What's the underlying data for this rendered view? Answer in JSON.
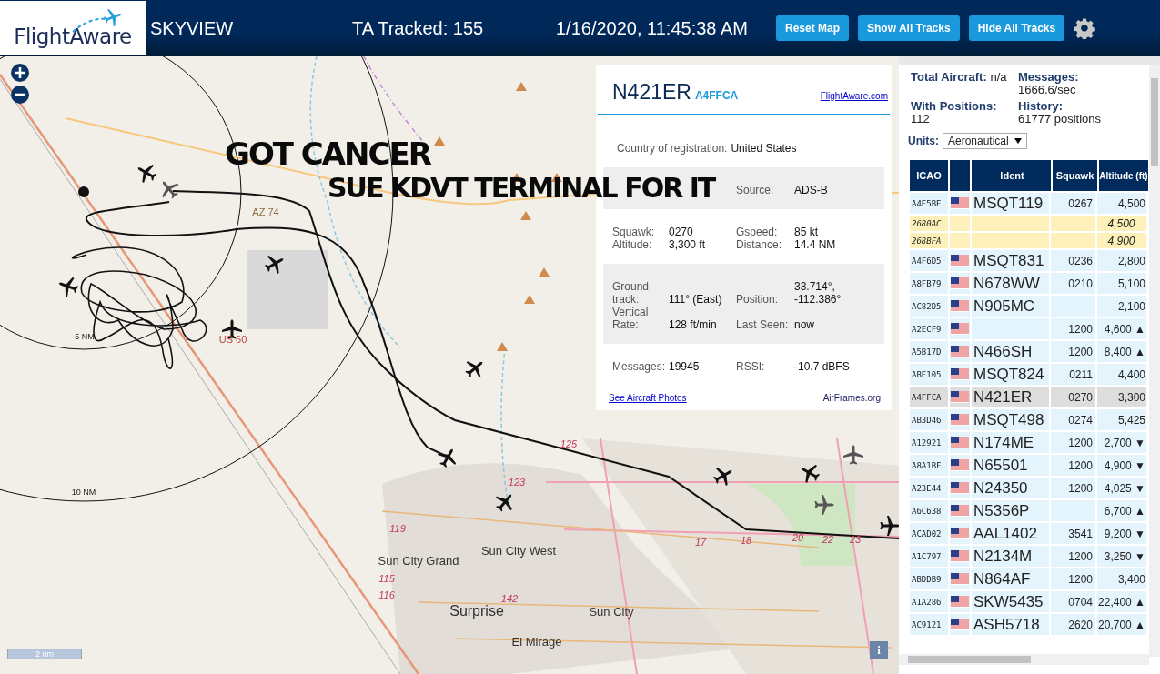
{
  "header": {
    "logo": "FlightAware",
    "title": "SKYVIEW",
    "tracked": "TA Tracked: 155",
    "datetime": "1/16/2020, 11:45:38 AM",
    "buttons": [
      "Reset Map",
      "Show All Tracks",
      "Hide All Tracks"
    ]
  },
  "map": {
    "scale": "2 nm",
    "info": "i",
    "labels": [
      {
        "text": "5 NM",
        "kind": "ring"
      },
      {
        "text": "10 NM",
        "kind": "ring"
      },
      {
        "text": "AZ 74",
        "kind": "state-shield"
      },
      {
        "text": "US 60",
        "kind": "us-shield"
      },
      {
        "text": "Sun City Grand",
        "kind": "town"
      },
      {
        "text": "Sun City West",
        "kind": "town"
      },
      {
        "text": "Surprise",
        "kind": "city"
      },
      {
        "text": "Sun City",
        "kind": "town"
      },
      {
        "text": "El Mirage",
        "kind": "town"
      },
      {
        "text": "119",
        "kind": "route"
      },
      {
        "text": "115",
        "kind": "route"
      },
      {
        "text": "116",
        "kind": "route"
      },
      {
        "text": "142",
        "kind": "route"
      },
      {
        "text": "123",
        "kind": "route"
      },
      {
        "text": "125",
        "kind": "route"
      },
      {
        "text": "17",
        "kind": "route"
      },
      {
        "text": "18",
        "kind": "route"
      },
      {
        "text": "20",
        "kind": "route"
      },
      {
        "text": "22",
        "kind": "route"
      },
      {
        "text": "23",
        "kind": "route"
      }
    ],
    "caption": [
      "GOT CANCER",
      "SUE KDVT TERMINAL FOR IT"
    ]
  },
  "popup": {
    "ident": "N421ER",
    "hex": "A4FFCA",
    "site_link": "FlightAware.com",
    "country_label": "Country of registration:",
    "country": "United States",
    "sections": [
      {
        "shaded": true,
        "cells": [
          [
            "Source:",
            "ADS-B"
          ]
        ]
      },
      {
        "shaded": false,
        "cells": [
          [
            "Squawk:",
            "0270"
          ],
          [
            "Gspeed:",
            "85 kt"
          ],
          [
            "Altitude:",
            "3,300 ft"
          ],
          [
            "Distance:",
            "14.4 NM"
          ]
        ]
      },
      {
        "shaded": true,
        "cells": [
          [
            "Ground track:",
            "111° (East)"
          ],
          [
            "Position:",
            "33.714°, -112.386°"
          ],
          [
            "Vertical Rate:",
            "128 ft/min"
          ],
          [
            "Last Seen:",
            "now"
          ]
        ]
      },
      {
        "shaded": false,
        "cells": [
          [
            "Messages:",
            "19945"
          ],
          [
            "RSSI:",
            "-10.7 dBFS"
          ]
        ]
      }
    ],
    "photos_link": "See Aircraft Photos",
    "airframes_link": "AirFrames.org"
  },
  "stats": [
    {
      "label": "Total Aircraft:",
      "value": "n/a"
    },
    {
      "label": "Messages:",
      "value": "1666.6/sec"
    },
    {
      "label": "With Positions:",
      "value": "112"
    },
    {
      "label": "History:",
      "value": "61777 positions"
    }
  ],
  "units": {
    "label": "Units:",
    "value": "Aeronautical"
  },
  "table": {
    "columns": [
      "ICAO",
      "Ident",
      "Squawk",
      "Altitude (ft)"
    ],
    "rows": [
      {
        "icao": "A4E5BE",
        "flag": true,
        "ident": "MSQT119",
        "squawk": "0267",
        "altitude": "4,500",
        "kind": "adsb",
        "selected": false
      },
      {
        "icao": "2680AC",
        "flag": false,
        "altitude": "4,500",
        "kind": "tisb",
        "selected": false
      },
      {
        "icao": "268BFA",
        "flag": false,
        "altitude": "4,900",
        "kind": "tisb",
        "selected": false
      },
      {
        "icao": "A4F6D5",
        "flag": true,
        "ident": "MSQT831",
        "squawk": "0236",
        "altitude": "2,800",
        "kind": "adsb",
        "selected": false
      },
      {
        "icao": "A8FB79",
        "flag": true,
        "ident": "N678WW",
        "squawk": "0210",
        "altitude": "5,100",
        "kind": "adsb",
        "selected": false
      },
      {
        "icao": "AC82D5",
        "flag": true,
        "ident": "N905MC",
        "altitude": "2,100",
        "kind": "adsb",
        "selected": false
      },
      {
        "icao": "A2ECF9",
        "flag": true,
        "squawk": "1200",
        "altitude": "4,600 ▲",
        "kind": "adsb",
        "selected": false
      },
      {
        "icao": "A5B17D",
        "flag": true,
        "ident": "N466SH",
        "squawk": "1200",
        "altitude": "8,400 ▲",
        "kind": "adsb",
        "selected": false
      },
      {
        "icao": "ABE105",
        "flag": true,
        "ident": "MSQT824",
        "squawk": "0211",
        "altitude": "4,400",
        "kind": "adsb",
        "selected": false
      },
      {
        "icao": "A4FFCA",
        "flag": true,
        "ident": "N421ER",
        "squawk": "0270",
        "altitude": "3,300",
        "kind": "adsb",
        "selected": true
      },
      {
        "icao": "AB3D46",
        "flag": true,
        "ident": "MSQT498",
        "squawk": "0274",
        "altitude": "5,425",
        "kind": "adsb",
        "selected": false
      },
      {
        "icao": "A12921",
        "flag": true,
        "ident": "N174ME",
        "squawk": "1200",
        "altitude": "2,700 ▼",
        "kind": "adsb",
        "selected": false
      },
      {
        "icao": "A8A1BF",
        "flag": true,
        "ident": "N65501",
        "squawk": "1200",
        "altitude": "4,900 ▼",
        "kind": "adsb",
        "selected": false
      },
      {
        "icao": "A23E44",
        "flag": true,
        "ident": "N24350",
        "squawk": "1200",
        "altitude": "4,025 ▼",
        "kind": "adsb",
        "selected": false
      },
      {
        "icao": "A6C638",
        "flag": true,
        "ident": "N5356P",
        "altitude": "6,700 ▲",
        "kind": "adsb",
        "selected": false
      },
      {
        "icao": "ACAD02",
        "flag": true,
        "ident": "AAL1402",
        "squawk": "3541",
        "altitude": "9,200 ▼",
        "kind": "adsb",
        "selected": false
      },
      {
        "icao": "A1C797",
        "flag": true,
        "ident": "N2134M",
        "squawk": "1200",
        "altitude": "3,250 ▼",
        "kind": "adsb",
        "selected": false
      },
      {
        "icao": "ABDDB9",
        "flag": true,
        "ident": "N864AF",
        "squawk": "1200",
        "altitude": "3,400",
        "kind": "adsb",
        "selected": false
      },
      {
        "icao": "A1A286",
        "flag": true,
        "ident": "SKW5435",
        "squawk": "0704",
        "altitude": "22,400 ▲",
        "kind": "adsb",
        "selected": false
      },
      {
        "icao": "AC9121",
        "flag": true,
        "ident": "ASH5718",
        "squawk": "2620",
        "altitude": "20,700 ▲",
        "kind": "adsb",
        "selected": false
      }
    ]
  }
}
